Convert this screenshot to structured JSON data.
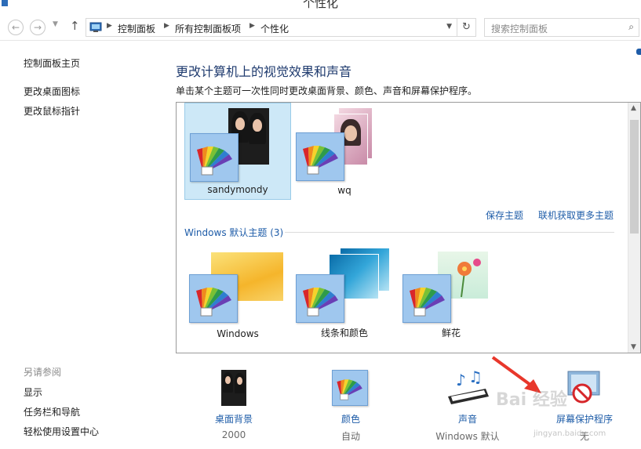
{
  "window": {
    "title": "个性化"
  },
  "address_bar": {
    "breadcrumbs": [
      "控制面板",
      "所有控制面板项",
      "个性化"
    ]
  },
  "search": {
    "placeholder": "搜索控制面板"
  },
  "sidebar": {
    "items": [
      {
        "label": "控制面板主页"
      },
      {
        "label": "更改桌面图标"
      },
      {
        "label": "更改鼠标指针"
      }
    ],
    "see_also_title": "另请参阅",
    "see_also": [
      {
        "label": "显示"
      },
      {
        "label": "任务栏和导航"
      },
      {
        "label": "轻松使用设置中心"
      }
    ]
  },
  "main": {
    "heading": "更改计算机上的视觉效果和声音",
    "subtitle": "单击某个主题可一次性同时更改桌面背景、颜色、声音和屏幕保护程序。",
    "my_themes": [
      {
        "label": "sandymondy",
        "selected": true
      },
      {
        "label": "wq",
        "selected": false
      }
    ],
    "save_theme": "保存主题",
    "get_more_themes": "联机获取更多主题",
    "default_group_title": "Windows 默认主题 (3)",
    "default_themes": [
      {
        "label": "Windows"
      },
      {
        "label": "线条和颜色"
      },
      {
        "label": "鲜花"
      }
    ]
  },
  "bottom": [
    {
      "title": "桌面背景",
      "value": "2000"
    },
    {
      "title": "颜色",
      "value": "自动"
    },
    {
      "title": "声音",
      "value": "Windows 默认"
    },
    {
      "title": "屏幕保护程序",
      "value": "无"
    }
  ],
  "watermark": {
    "text": "Bai 经验",
    "url_text": "jingyan.baidu.com"
  },
  "colors": {
    "link": "#1e5ca8",
    "heading": "#1e3a6e",
    "selected_bg": "#cde8f7",
    "arrow": "#e8372b"
  }
}
